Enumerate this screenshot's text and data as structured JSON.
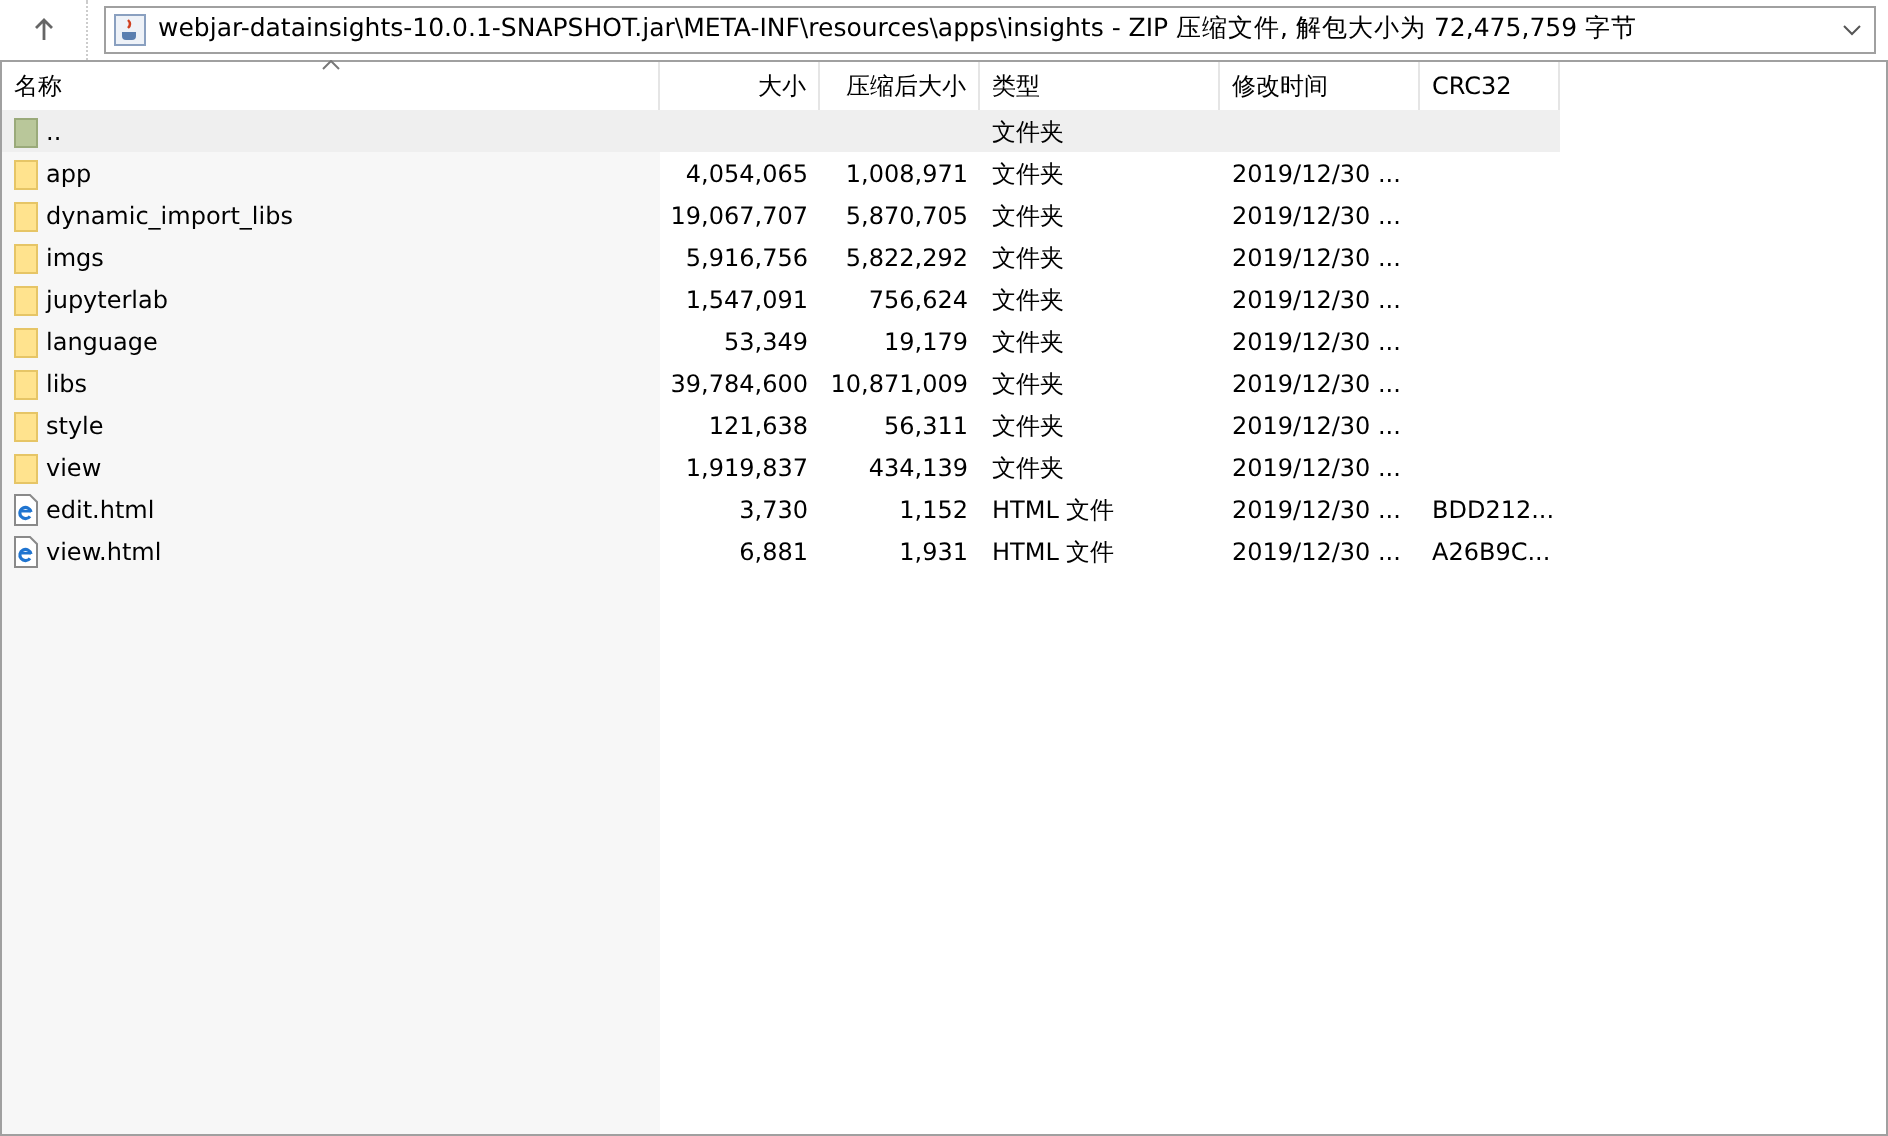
{
  "address_bar": {
    "path": "webjar-datainsights-10.0.1-SNAPSHOT.jar\\META-INF\\resources\\apps\\insights - ZIP 压缩文件, 解包大小为 72,475,759 字节"
  },
  "table": {
    "columns": [
      "名称",
      "大小",
      "压缩后大小",
      "类型",
      "修改时间",
      "CRC32"
    ],
    "rows": [
      {
        "kind": "parent",
        "selected": true,
        "name": "..",
        "size": "",
        "packed": "",
        "type": "文件夹",
        "modified": "",
        "crc": ""
      },
      {
        "kind": "folder",
        "selected": false,
        "name": "app",
        "size": "4,054,065",
        "packed": "1,008,971",
        "type": "文件夹",
        "modified": "2019/12/30 ...",
        "crc": ""
      },
      {
        "kind": "folder",
        "selected": false,
        "name": "dynamic_import_libs",
        "size": "19,067,707",
        "packed": "5,870,705",
        "type": "文件夹",
        "modified": "2019/12/30 ...",
        "crc": ""
      },
      {
        "kind": "folder",
        "selected": false,
        "name": "imgs",
        "size": "5,916,756",
        "packed": "5,822,292",
        "type": "文件夹",
        "modified": "2019/12/30 ...",
        "crc": ""
      },
      {
        "kind": "folder",
        "selected": false,
        "name": "jupyterlab",
        "size": "1,547,091",
        "packed": "756,624",
        "type": "文件夹",
        "modified": "2019/12/30 ...",
        "crc": ""
      },
      {
        "kind": "folder",
        "selected": false,
        "name": "language",
        "size": "53,349",
        "packed": "19,179",
        "type": "文件夹",
        "modified": "2019/12/30 ...",
        "crc": ""
      },
      {
        "kind": "folder",
        "selected": false,
        "name": "libs",
        "size": "39,784,600",
        "packed": "10,871,009",
        "type": "文件夹",
        "modified": "2019/12/30 ...",
        "crc": ""
      },
      {
        "kind": "folder",
        "selected": false,
        "name": "style",
        "size": "121,638",
        "packed": "56,311",
        "type": "文件夹",
        "modified": "2019/12/30 ...",
        "crc": ""
      },
      {
        "kind": "folder",
        "selected": false,
        "name": "view",
        "size": "1,919,837",
        "packed": "434,139",
        "type": "文件夹",
        "modified": "2019/12/30 ...",
        "crc": ""
      },
      {
        "kind": "html",
        "selected": false,
        "name": "edit.html",
        "size": "3,730",
        "packed": "1,152",
        "type": "HTML 文件",
        "modified": "2019/12/30 ...",
        "crc": "BDD212..."
      },
      {
        "kind": "html",
        "selected": false,
        "name": "view.html",
        "size": "6,881",
        "packed": "1,931",
        "type": "HTML 文件",
        "modified": "2019/12/30 ...",
        "crc": "A26B9C..."
      }
    ]
  }
}
